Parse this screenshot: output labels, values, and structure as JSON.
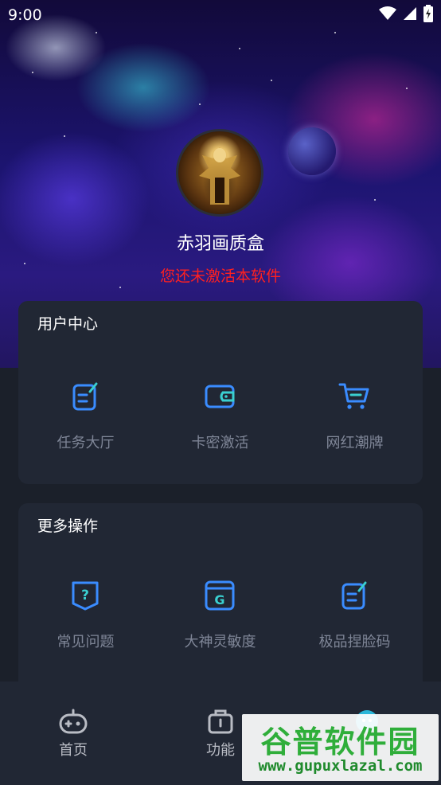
{
  "status_bar": {
    "time": "9:00",
    "icons": [
      "wifi-icon",
      "signal-icon",
      "battery-icon"
    ]
  },
  "profile": {
    "app_name": "赤羽画质盒",
    "activation_status": "您还未激活本软件"
  },
  "user_center": {
    "title": "用户中心",
    "items": [
      {
        "label": "任务大厅",
        "icon": "edit-note-icon"
      },
      {
        "label": "卡密激活",
        "icon": "wallet-icon"
      },
      {
        "label": "网红潮牌",
        "icon": "shopping-cart-icon"
      }
    ]
  },
  "more_actions": {
    "title": "更多操作",
    "items": [
      {
        "label": "常见问题",
        "icon": "question-shield-icon"
      },
      {
        "label": "大神灵敏度",
        "icon": "g-card-icon"
      },
      {
        "label": "极品捏脸码",
        "icon": "edit-note-icon"
      }
    ]
  },
  "bottom_nav": {
    "items": [
      {
        "label": "首页",
        "icon": "gamepad-icon"
      },
      {
        "label": "功能",
        "icon": "toolbox-icon"
      },
      {
        "label": "",
        "icon": "profile-icon"
      }
    ]
  },
  "watermark": {
    "title": "谷普软件园",
    "url": "www.gupuxlazal.com"
  },
  "colors": {
    "accent": "#3a8cff",
    "background": "#1b202a",
    "card": "#212734",
    "warning": "#ff2020",
    "muted_text": "#7f8697"
  }
}
